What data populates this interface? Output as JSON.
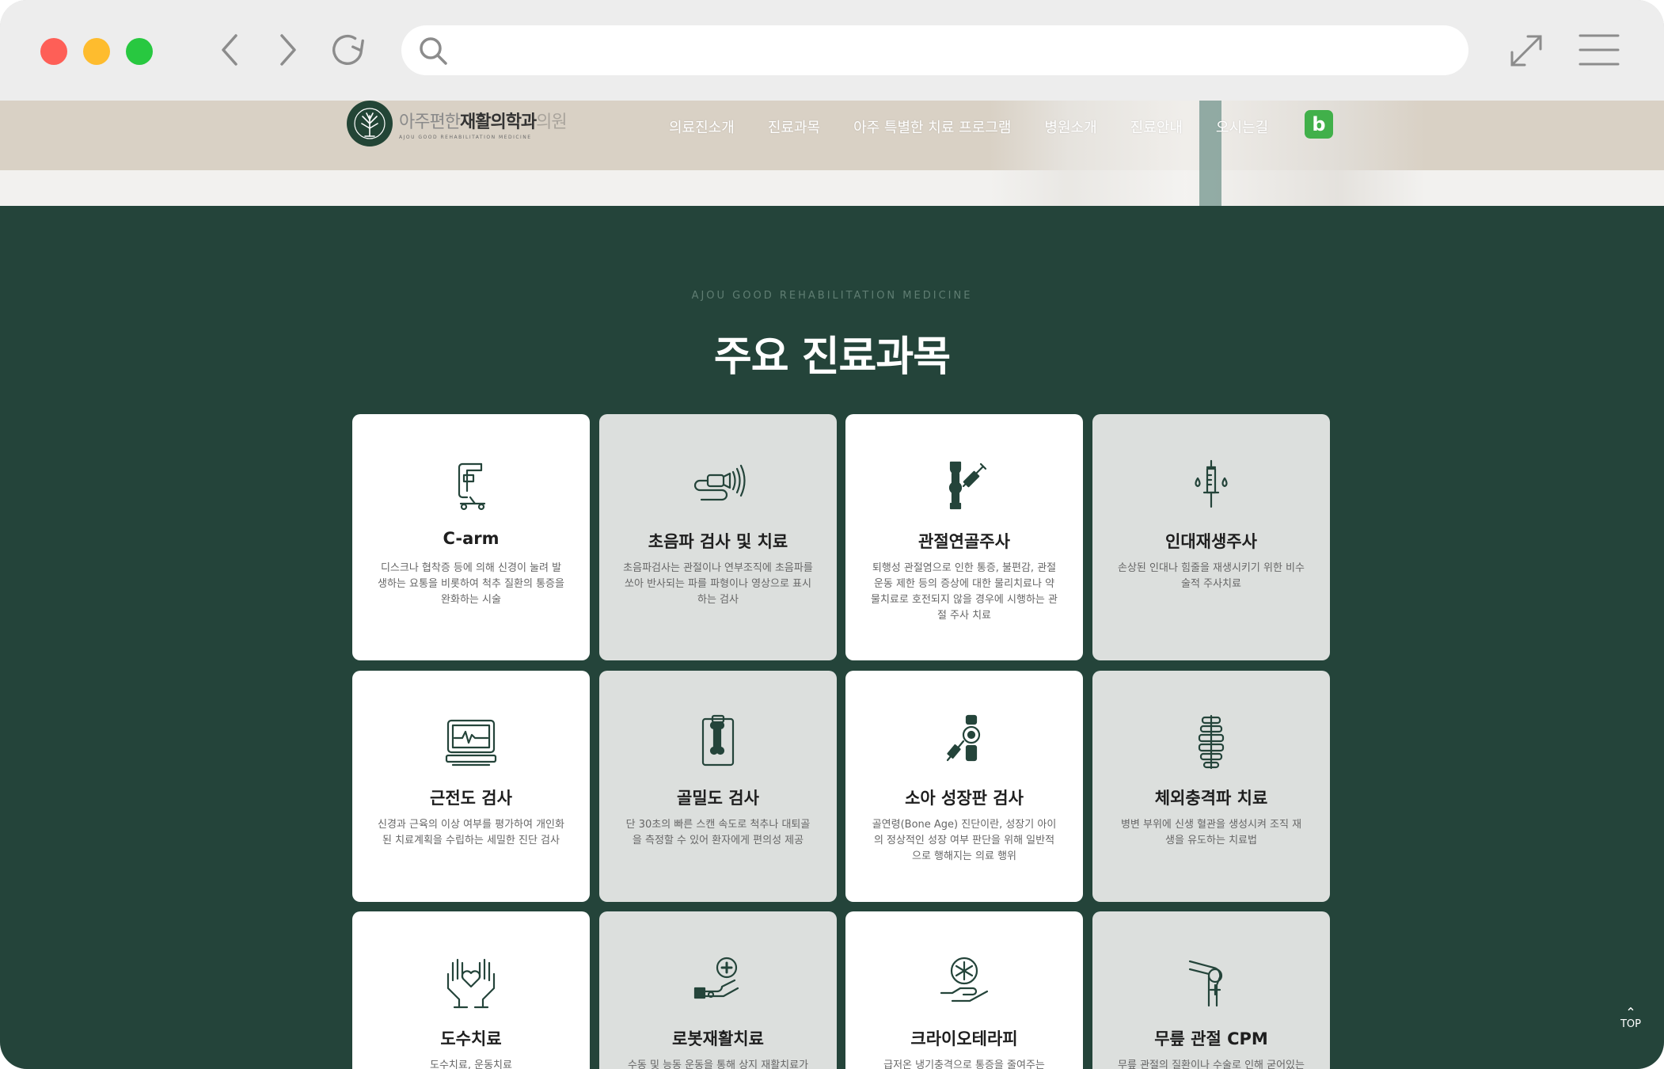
{
  "browser": {
    "address_value": "",
    "icons": [
      "back-icon",
      "forward-icon",
      "reload-icon",
      "search-icon",
      "expand-icon",
      "menu-icon"
    ]
  },
  "site": {
    "logo_main": "아주편한",
    "logo_bold": "재활의학과",
    "logo_suffix": "의원",
    "logo_sub": "AJOU GOOD REHABILITATION MEDICINE",
    "nav": [
      "의료진소개",
      "진료과목",
      "아주 특별한 치료 프로그램",
      "병원소개",
      "진료안내",
      "오시는길"
    ],
    "blog_label": "b",
    "blog_color": "#41b04a"
  },
  "section": {
    "eyebrow": "AJOU GOOD REHABILITATION MEDICINE",
    "title": "주요 진료과목",
    "background": "#24443a"
  },
  "cards": [
    {
      "title": "C-arm",
      "desc": "디스크나 협착증 등에 의해 신경이 눌려 발생하는 요통을 비롯하여 척추 질환의 통증을 완화하는 시술",
      "icon": "c-arm-icon"
    },
    {
      "title": "초음파 검사 및 치료",
      "desc": "초음파검사는 관절이나 연부조직에 초음파를 쏘아 반사되는 파를 파형이나 영상으로 표시하는 검사",
      "icon": "ultrasound-icon"
    },
    {
      "title": "관절연골주사",
      "desc": "퇴행성 관절염으로 인한 통증, 불편감, 관절운동 제한 등의 증상에 대한 물리치료나 약물치료로 호전되지 않을 경우에 시행하는 관절 주사 치료",
      "icon": "joint-injection-icon"
    },
    {
      "title": "인대재생주사",
      "desc": "손상된 인대나 힘줄을 재생시키기 위한 비수술적 주사치료",
      "icon": "syringe-icon"
    },
    {
      "title": "근전도 검사",
      "desc": "신경과 근육의 이상 여부를 평가하여 개인화된 치료계획을 수립하는 세밀한 진단 검사",
      "icon": "emg-monitor-icon"
    },
    {
      "title": "골밀도 검사",
      "desc": "단 30초의 빠른 스캔 속도로 척추나 대퇴골을 측정할 수 있어 환자에게 편의성 제공",
      "icon": "bone-scan-icon"
    },
    {
      "title": "소아 성장판 검사",
      "desc": "골연령(Bone Age) 진단이란, 성장기 아이의 정상적인 성장 여부 판단을 위해 일반적으로 행해지는 의료 행위",
      "icon": "growth-plate-icon"
    },
    {
      "title": "체외충격파 치료",
      "desc": "병변 부위에 신생 혈관을 생성시켜 조직 재생을 유도하는 치료법",
      "icon": "spine-icon"
    },
    {
      "title": "도수치료",
      "desc": "도수치료, 운동치료",
      "icon": "hands-heart-icon"
    },
    {
      "title": "로봇재활치료",
      "desc": "수동 및 능동 운동을 통해 상지 재활치료가",
      "icon": "robot-rehab-icon"
    },
    {
      "title": "크라이오테라피",
      "desc": "급저온 냉기충격으로 통증을 줄여주는",
      "icon": "cryo-icon"
    },
    {
      "title": "무릎 관절 CPM",
      "desc": "무릎 관절의 질환이나 수술로 인해 굳어있는",
      "icon": "knee-cpm-icon"
    }
  ],
  "top_button": "TOP"
}
